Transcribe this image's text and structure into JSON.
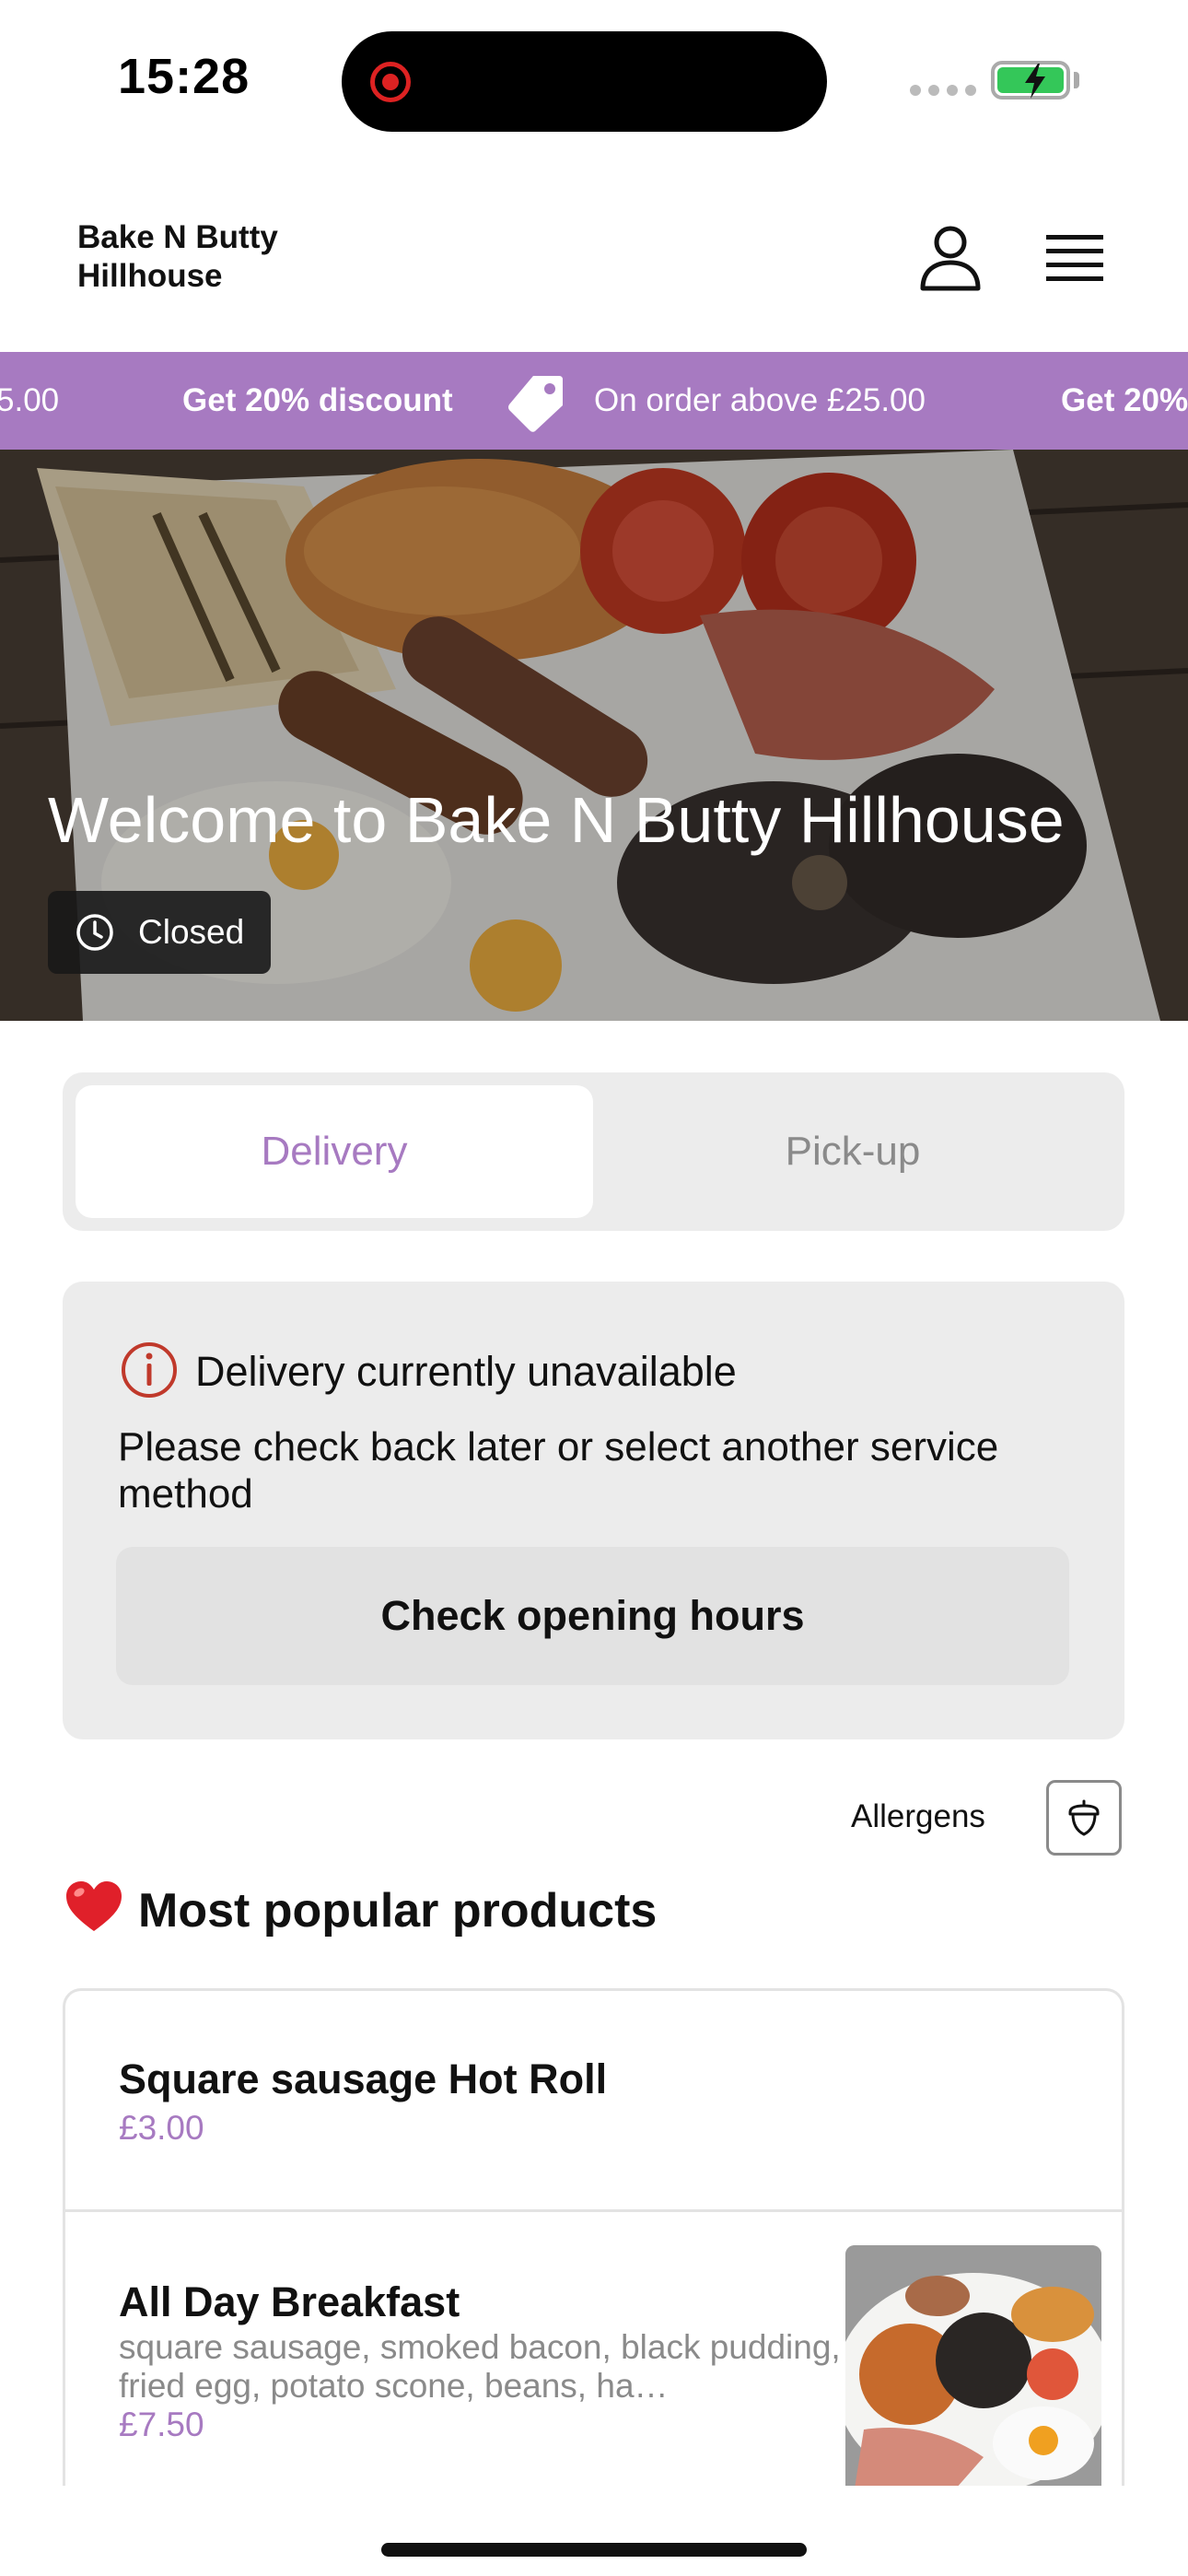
{
  "status_bar": {
    "time": "15:28"
  },
  "header": {
    "brand_line1": "Bake N Butty",
    "brand_line2": "Hillhouse",
    "icons": [
      "user-icon",
      "hamburger-menu-icon"
    ]
  },
  "promo": {
    "left_partial": "5.00",
    "headline": "Get 20% discount",
    "condition": "On order above £25.00",
    "right_partial": "Get 20%",
    "color": "#a77ac1"
  },
  "hero": {
    "title": "Welcome to Bake N Butty Hillhouse",
    "status": "Closed"
  },
  "service_tabs": {
    "active": "Delivery",
    "inactive": "Pick-up",
    "accent": "#a77ac1"
  },
  "notice": {
    "title": "Delivery currently unavailable",
    "message": "Please check back later or select another service method",
    "button": "Check opening hours",
    "icon_color": "#c0392b"
  },
  "allergens": {
    "label": "Allergens"
  },
  "popular": {
    "heading": "Most popular products",
    "products": [
      {
        "name": "Square  sausage Hot Roll",
        "description": "",
        "price": "£3.00"
      },
      {
        "name": "All Day Breakfast",
        "description": "square sausage, smoked bacon, black pudding, fried egg, potato scone, beans, ha…",
        "price": "£7.50"
      }
    ]
  }
}
